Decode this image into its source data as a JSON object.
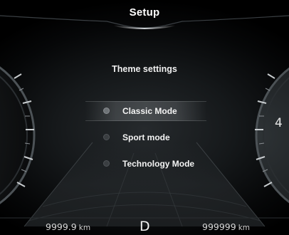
{
  "header": {
    "title": "Setup"
  },
  "menu": {
    "subtitle": "Theme settings",
    "options": [
      {
        "label": "Classic Mode",
        "selected": true
      },
      {
        "label": "Sport mode",
        "selected": false
      },
      {
        "label": "Technology Mode",
        "selected": false
      }
    ]
  },
  "status": {
    "trip_value": "9999.9",
    "trip_unit": "km",
    "gear": "D",
    "odometer_value": "999999",
    "odometer_unit": "km"
  },
  "gauge_right": {
    "visible_numeral": "4"
  },
  "colors": {
    "background": "#15181a",
    "text": "#f2f2f2",
    "highlight": "#c8cdd2"
  }
}
